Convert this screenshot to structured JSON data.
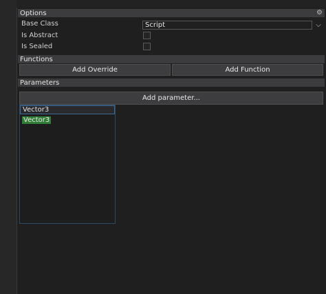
{
  "sections": {
    "options": "Options",
    "functions": "Functions",
    "parameters": "Parameters"
  },
  "icons": {
    "options_settings": "gear-icon",
    "dropdown": "chevron-down-icon"
  },
  "options": {
    "base_class_label": "Base Class",
    "base_class_value": "Script",
    "is_abstract_label": "Is Abstract",
    "is_abstract_checked": false,
    "is_sealed_label": "Is Sealed",
    "is_sealed_checked": false
  },
  "functions": {
    "add_override_label": "Add Override",
    "add_function_label": "Add Function"
  },
  "parameters": {
    "add_parameter_label": "Add parameter...",
    "items": [
      "Vector3",
      "Vector3"
    ]
  },
  "colors": {
    "accent_blue": "#3c6b97",
    "highlight_green": "#2f7d36",
    "header_bg": "#3c3c3e",
    "panel_bg": "#1f1f1f"
  }
}
